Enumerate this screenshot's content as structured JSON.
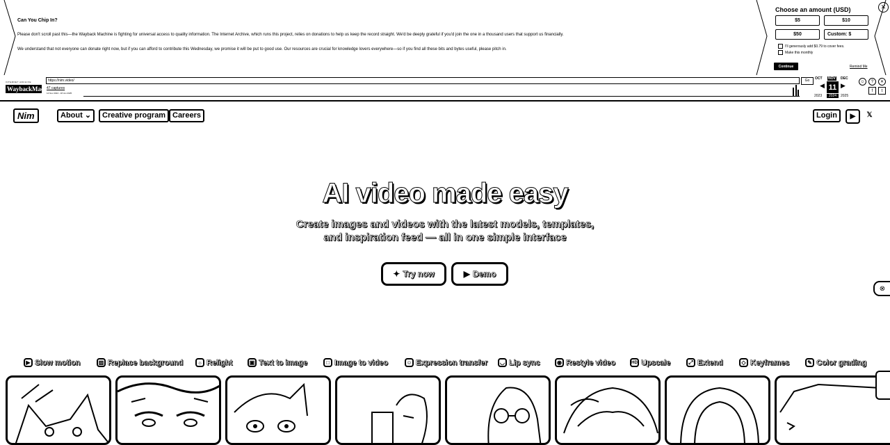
{
  "donation": {
    "title": "Can You Chip In?",
    "paragraph1": "Please don't scroll past this—the Wayback Machine is fighting for universal access to quality information. The Internet Archive, which runs this project, relies on donations to help us keep the record straight. We'd be deeply grateful if you'd join the one in a thousand users that support us financially.",
    "paragraph2": "We understand that not everyone can donate right now, but if you can afford to contribute this Wednesday, we promise it will be put to good use. Our resources are crucial for knowledge lovers everywhere—so if you find all these bits and bytes useful, please pitch in.",
    "choose_label": "Choose an amount (USD)",
    "amounts": [
      "$5",
      "$10",
      "$50",
      "Custom: $"
    ],
    "checkbox_fee": "I'll generously add $0.79 to cover fees.",
    "checkbox_monthly": "Make this monthly",
    "continue_label": "Continue",
    "remind_label": "Remind Me",
    "close_label": "✕"
  },
  "wayback": {
    "logo_small": "INTERNET ARCHIVE",
    "logo_big": "WaybackMachine",
    "url": "https://nim.video/",
    "go_label": "Go",
    "captures": "47 captures",
    "range": "14 Nov 2024 - 18 Jun 2025",
    "months": [
      "OCT",
      "NOV",
      "DEC"
    ],
    "day": "11",
    "year": "2024",
    "year_left": "2023",
    "year_right": "2025"
  },
  "nav": {
    "logo": "Nim",
    "about": "About",
    "creative_program": "Creative program",
    "careers": "Careers",
    "login": "Login"
  },
  "hero": {
    "title": "AI video made easy",
    "subtitle_line1": "Create images and videos with the latest models, templates,",
    "subtitle_line2": "and inspiration feed — all in one simple interface",
    "try_now": "Try now",
    "demo": "Demo"
  },
  "features": [
    {
      "label": "Slow motion",
      "icon": "play-circle-icon"
    },
    {
      "label": "Replace background",
      "icon": "hatched-square-icon"
    },
    {
      "label": "Relight",
      "icon": "bulb-icon"
    },
    {
      "label": "Text to image",
      "icon": "image-icon"
    },
    {
      "label": "Image to video",
      "icon": "square-icon"
    },
    {
      "label": "Expression transfer",
      "icon": "smile-icon"
    },
    {
      "label": "Lip sync",
      "icon": "lips-icon"
    },
    {
      "label": "Restyle video",
      "icon": "eye-icon"
    },
    {
      "label": "Upscale",
      "icon": "hd-icon"
    },
    {
      "label": "Extend",
      "icon": "extend-icon"
    },
    {
      "label": "Keyframes",
      "icon": "keyframes-icon"
    },
    {
      "label": "Color grading",
      "icon": "brush-icon"
    }
  ]
}
